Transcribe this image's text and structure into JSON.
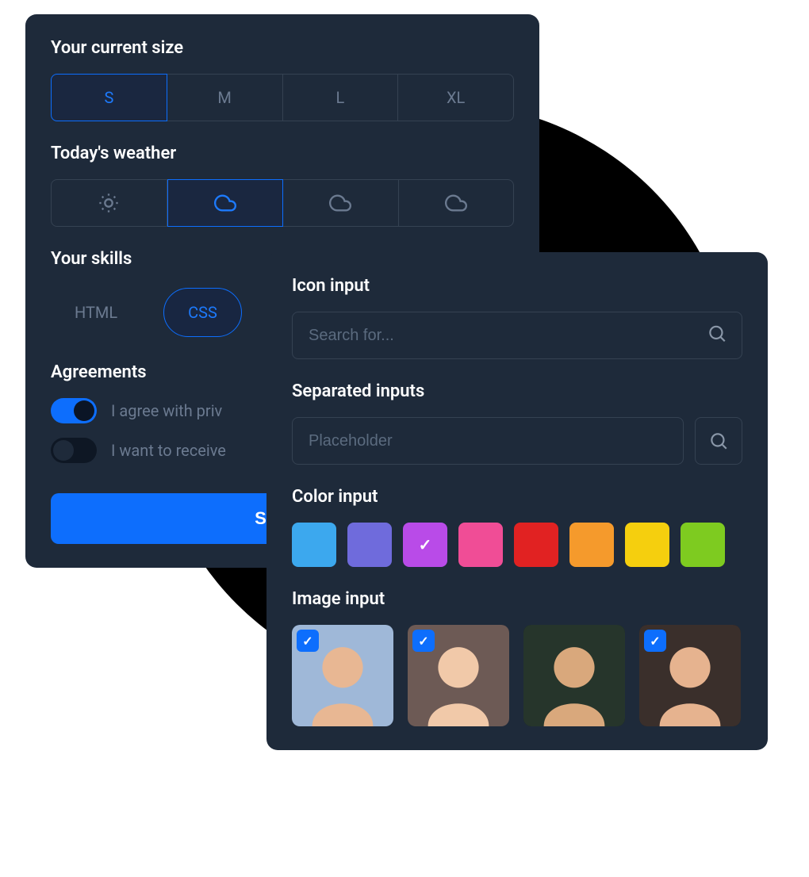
{
  "left": {
    "size_label": "Your current size",
    "sizes": [
      "S",
      "M",
      "L",
      "XL"
    ],
    "size_selected": 0,
    "weather_label": "Today's weather",
    "weather_options": [
      "sunny",
      "cloud",
      "cloud2",
      "cloud3"
    ],
    "weather_selected": 1,
    "skills_label": "Your skills",
    "skills": [
      "HTML",
      "CSS"
    ],
    "skill_selected": 1,
    "agreements_label": "Agreements",
    "toggles": [
      {
        "label": "I agree with priv",
        "on": true
      },
      {
        "label": "I want to receive",
        "on": false
      }
    ],
    "save_label": "Save c"
  },
  "right": {
    "icon_input_label": "Icon input",
    "icon_input_placeholder": "Search for...",
    "separated_label": "Separated inputs",
    "separated_placeholder": "Placeholder",
    "color_label": "Color input",
    "colors": [
      {
        "hex": "#3ca8ee",
        "selected": false
      },
      {
        "hex": "#6f6bdc",
        "selected": false
      },
      {
        "hex": "#b94be8",
        "selected": true
      },
      {
        "hex": "#f04d96",
        "selected": false
      },
      {
        "hex": "#e12222",
        "selected": false
      },
      {
        "hex": "#f59a2c",
        "selected": false
      },
      {
        "hex": "#f5cf0e",
        "selected": false
      },
      {
        "hex": "#7ecb20",
        "selected": false
      }
    ],
    "image_label": "Image input",
    "images": [
      {
        "selected": true
      },
      {
        "selected": true
      },
      {
        "selected": false
      },
      {
        "selected": true
      }
    ]
  }
}
